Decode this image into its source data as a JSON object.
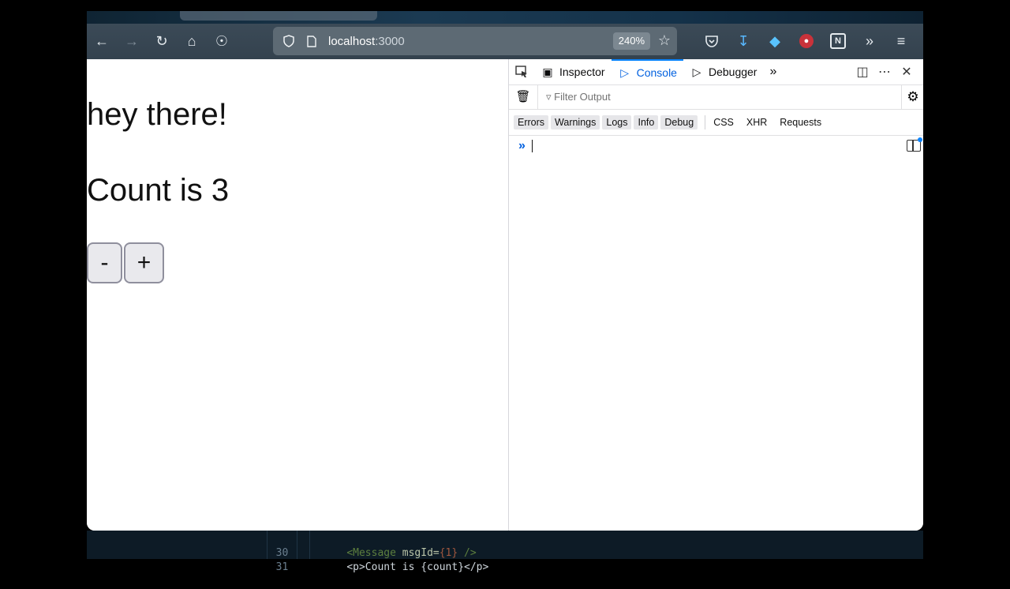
{
  "browser": {
    "url_host": "localhost",
    "url_port": ":3000",
    "zoom": "240%"
  },
  "page": {
    "heading": "hey there!",
    "count_text": "Count is 3",
    "minus_label": "-",
    "plus_label": "+"
  },
  "devtools": {
    "tabs": {
      "inspector": "Inspector",
      "console": "Console",
      "debugger": "Debugger"
    },
    "filter_placeholder": "Filter Output",
    "levels": [
      "Errors",
      "Warnings",
      "Logs",
      "Info",
      "Debug"
    ],
    "requests": [
      "CSS",
      "XHR",
      "Requests"
    ]
  },
  "editor_peek": {
    "line_30_num": "30",
    "line_30_tag": "<Message",
    "line_30_attr": " msgId=",
    "line_30_val": "{1}",
    "line_30_end": " />",
    "line_31_num": "31",
    "line_31_text": "<p>Count is {count}</p>"
  },
  "icons": {
    "back": "arrow-left-icon",
    "forward": "arrow-right-icon",
    "reload": "reload-icon",
    "home": "home-icon",
    "extensions": "puzzle-icon"
  }
}
